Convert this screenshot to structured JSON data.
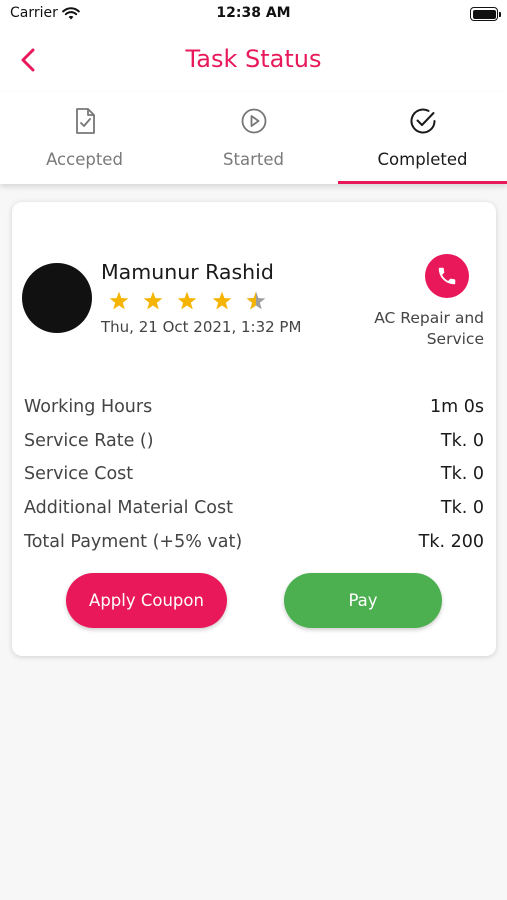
{
  "status_bar": {
    "carrier": "Carrier",
    "time": "12:38 AM"
  },
  "header": {
    "title": "Task Status"
  },
  "tabs": [
    {
      "label": "Accepted",
      "icon": "document-check-icon",
      "active": false
    },
    {
      "label": "Started",
      "icon": "play-circle-icon",
      "active": false
    },
    {
      "label": "Completed",
      "icon": "check-circle-icon",
      "active": true
    }
  ],
  "task": {
    "name": "Mamunur Rashid",
    "rating": 4.5,
    "date": "Thu, 21 Oct 2021, 1:32 PM",
    "service": "AC Repair and Service",
    "rows": [
      {
        "label": "Working Hours",
        "value": "1m 0s"
      },
      {
        "label": "Service Rate ()",
        "value": "Tk. 0"
      },
      {
        "label": "Service Cost",
        "value": "Tk. 0"
      },
      {
        "label": "Additional Material Cost",
        "value": "Tk. 0"
      },
      {
        "label": "Total Payment (+5% vat)",
        "value": "Tk. 200"
      }
    ]
  },
  "actions": {
    "apply_coupon": "Apply Coupon",
    "pay": "Pay"
  },
  "colors": {
    "accent": "#e8185a",
    "pay": "#4caf50",
    "star": "#f5b400",
    "star_empty": "#9e9e9e"
  }
}
